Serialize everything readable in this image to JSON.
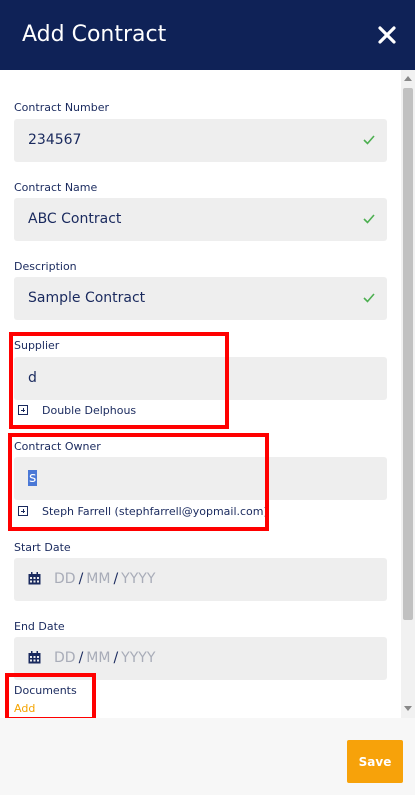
{
  "header": {
    "title": "Add Contract",
    "close_icon": "close-icon"
  },
  "form": {
    "contract_number": {
      "label": "Contract Number",
      "value": "234567"
    },
    "contract_name": {
      "label": "Contract Name",
      "value": "ABC Contract"
    },
    "description": {
      "label": "Description",
      "value": "Sample Contract"
    },
    "supplier": {
      "label": "Supplier",
      "value": "d",
      "suggestion": "Double Delphous"
    },
    "contract_owner": {
      "label": "Contract Owner",
      "value": "s",
      "suggestion": "Steph Farrell (stephfarrell@yopmail.com)"
    },
    "start_date": {
      "label": "Start Date",
      "dd": "DD",
      "mm": "MM",
      "yyyy": "YYYY",
      "sep": "/"
    },
    "end_date": {
      "label": "End Date",
      "dd": "DD",
      "mm": "MM",
      "yyyy": "YYYY",
      "sep": "/"
    },
    "documents": {
      "label": "Documents",
      "add_label": "Add"
    }
  },
  "footer": {
    "save_label": "Save"
  },
  "colors": {
    "header_bg": "#0f2257",
    "accent": "#f7a20a",
    "field_bg": "#eeeeee",
    "valid_check": "#4caf50",
    "highlight_box": "#ff0000"
  }
}
